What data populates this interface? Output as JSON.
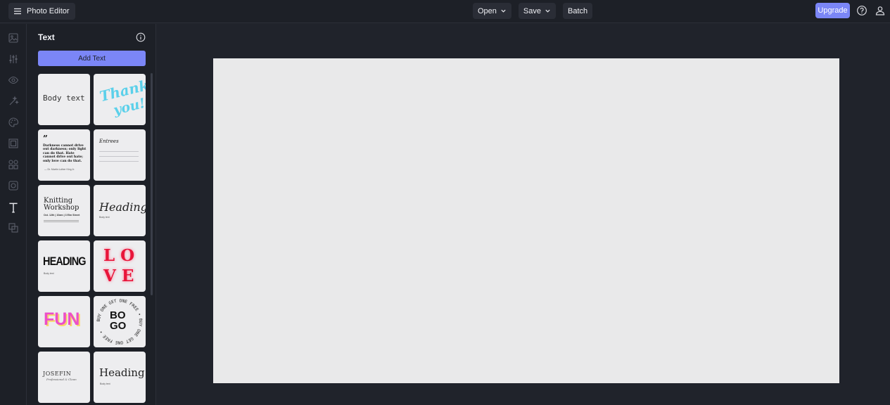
{
  "header": {
    "app_title": "Photo Editor",
    "open_label": "Open",
    "save_label": "Save",
    "batch_label": "Batch",
    "upgrade_label": "Upgrade"
  },
  "sidebar": {
    "icons": [
      "image-icon",
      "adjustments-icon",
      "eye-icon",
      "effects-icon",
      "palette-icon",
      "frame-icon",
      "shapes-icon",
      "overlay-icon",
      "text-icon",
      "layers-icon"
    ]
  },
  "panel": {
    "title": "Text",
    "add_text_label": "Add Text",
    "templates": {
      "body_text": "Body text",
      "thank_you_1": "Thank",
      "thank_you_2": "you!",
      "quote_mark": "”",
      "quote": "Darkness cannot drive out darkness; only light can do that. Hate cannot drive out hate; only love can do that.",
      "quote_author": "— Dr. Martin Luther King Jr.",
      "menu_title": "Entrees",
      "knitting_1": "Knitting",
      "knitting_2": "Workshop",
      "knitting_detail": "Oct. 12th | 10am | 3 Elm Street",
      "heading_script": "Heading",
      "heading_script_sub": "Body text",
      "heading_bold": "HEADING",
      "heading_bold_sub": "Body text",
      "love_1": "L O",
      "love_2": "V E",
      "fun": "FUN",
      "bogo_1": "BO",
      "bogo_2": "GO",
      "bogo_ring": "BUY ONE GET ONE FREE • BUY ONE GET ONE FREE •",
      "josefin": "JOSEFIN",
      "josefin_sub": "Professional & Clean",
      "heading_serif": "Heading",
      "heading_serif_sub": "Body text"
    }
  },
  "colors": {
    "accent": "#7b86f7",
    "background": "#20232b",
    "canvas": "#e9e9ea"
  }
}
